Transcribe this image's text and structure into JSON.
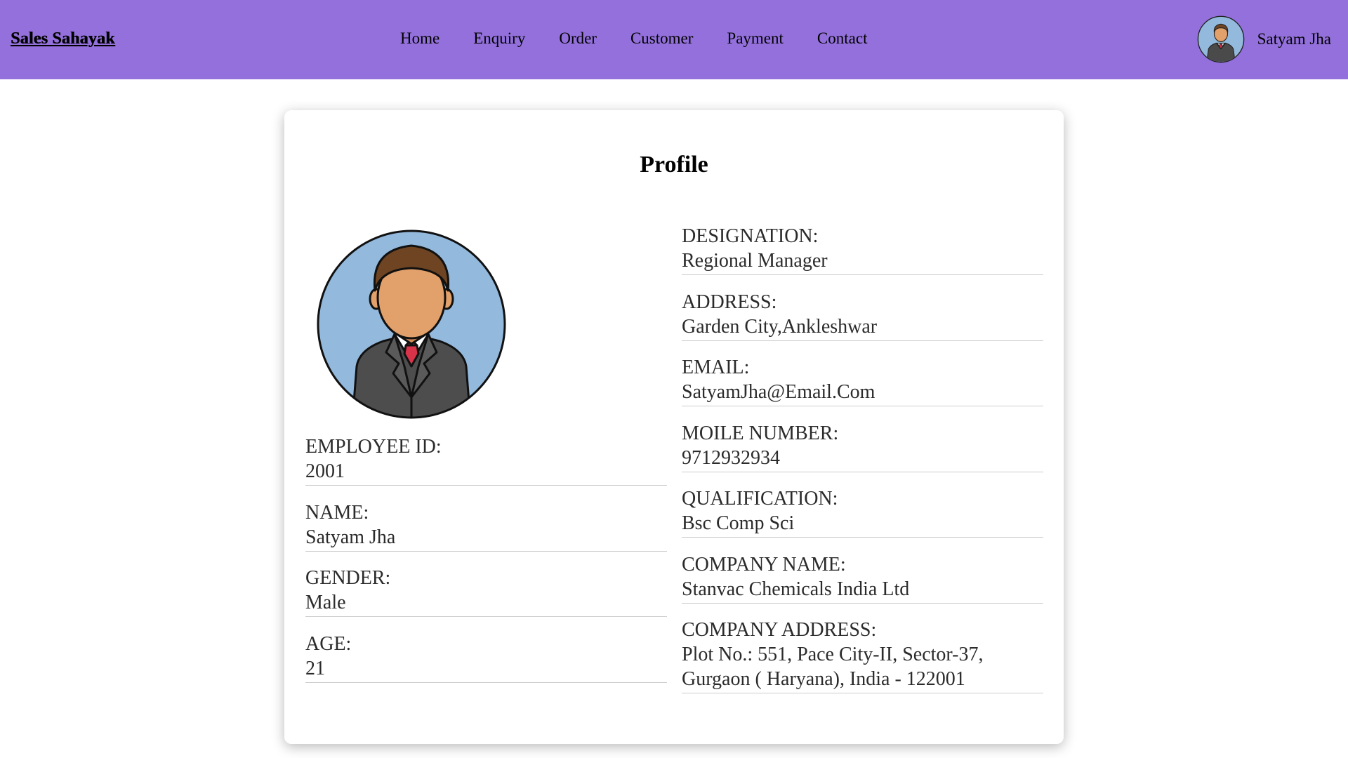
{
  "navbar": {
    "brand": "Sales Sahayak",
    "links": [
      "Home",
      "Enquiry",
      "Order",
      "Customer",
      "Payment",
      "Contact"
    ],
    "user_name": "Satyam Jha",
    "color": "#9370db"
  },
  "profile": {
    "title": "Profile",
    "left_fields": [
      {
        "label": "EMPLOYEE ID:",
        "value": "2001"
      },
      {
        "label": "NAME:",
        "value": "Satyam Jha"
      },
      {
        "label": "GENDER:",
        "value": "Male"
      },
      {
        "label": "AGE:",
        "value": "21"
      }
    ],
    "right_fields": [
      {
        "label": "DESIGNATION:",
        "value": "Regional Manager"
      },
      {
        "label": "ADDRESS:",
        "value": "Garden City,Ankleshwar"
      },
      {
        "label": "EMAIL:",
        "value": "SatyamJha@Email.Com"
      },
      {
        "label": "MOILE NUMBER:",
        "value": "9712932934"
      },
      {
        "label": "QUALIFICATION:",
        "value": "Bsc Comp Sci"
      },
      {
        "label": "COMPANY NAME:",
        "value": "Stanvac Chemicals India Ltd"
      },
      {
        "label": "COMPANY ADDRESS:",
        "value": "Plot No.: 551, Pace City-II, Sector-37,",
        "value2": "Gurgaon ( Haryana), India - 122001"
      }
    ]
  },
  "icons": {
    "user_avatar": "user-avatar-icon",
    "profile_avatar": "profile-avatar-icon"
  }
}
